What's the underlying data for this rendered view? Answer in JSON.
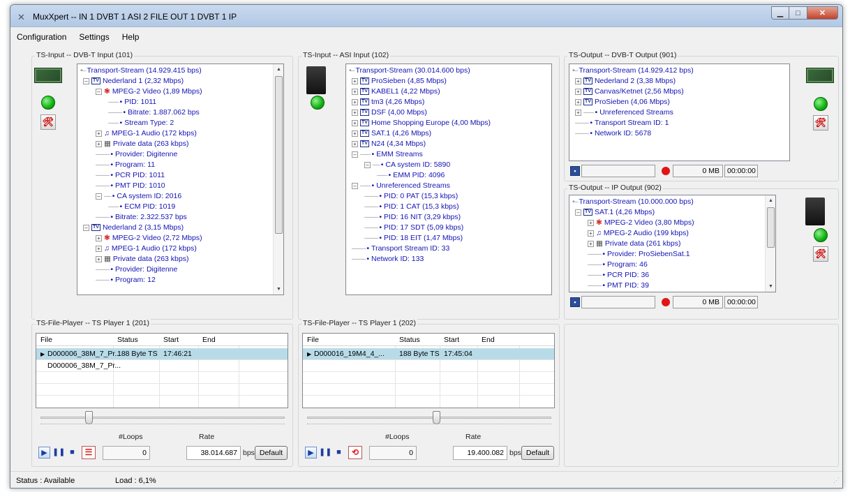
{
  "window": {
    "title": "MuxXpert -- IN 1 DVBT 1 ASI 2 FILE OUT 1 DVBT 1 IP"
  },
  "menu": [
    "Configuration",
    "Settings",
    "Help"
  ],
  "panels": {
    "input1": {
      "title": "TS-Input -- DVB-T Input (101)",
      "rows": [
        "Transport-Stream (14.929.415 bps)",
        "Nederland 1 (2,32 Mbps)",
        "MPEG-2 Video (1,89 Mbps)",
        "PID: 1011",
        "Bitrate: 1.887.062 bps",
        "Stream Type: 2",
        "MPEG-1 Audio (172 kbps)",
        "Private data (263 kbps)",
        "Provider: Digitenne",
        "Program: 11",
        "PCR PID: 1011",
        "PMT PID: 1010",
        "CA system ID: 2016",
        "ECM PID: 1019",
        "Bitrate: 2.322.537 bps",
        "Nederland 2 (3,15 Mbps)",
        "MPEG-2 Video (2,72 Mbps)",
        "MPEG-1 Audio (172 kbps)",
        "Private data (263 kbps)",
        "Provider: Digitenne",
        "Program: 12"
      ]
    },
    "input2": {
      "title": "TS-Input -- ASI Input (102)",
      "rows": [
        "Transport-Stream (30.014.600 bps)",
        "ProSieben (4,85 Mbps)",
        "KABEL1 (4,22 Mbps)",
        "tm3 (4,26 Mbps)",
        "DSF (4,00 Mbps)",
        "Home Shopping Europe (4,00 Mbps)",
        "SAT.1 (4,26 Mbps)",
        "N24 (4,34 Mbps)",
        "EMM Streams",
        "CA system ID: 5890",
        "EMM PID: 4096",
        "Unreferenced Streams",
        "PID: 0 PAT (15,3 kbps)",
        "PID: 1 CAT (15,3 kbps)",
        "PID: 16 NIT (3,29 kbps)",
        "PID: 17 SDT (5,09 kbps)",
        "PID: 18 EIT (1,47 Mbps)",
        "Transport Stream ID: 33",
        "Network ID: 133"
      ]
    },
    "output1": {
      "title": "TS-Output -- DVB-T Output (901)",
      "rows": [
        "Transport-Stream (14.929.412 bps)",
        "Nederland 2 (3,38 Mbps)",
        "Canvas/Ketnet (2,56 Mbps)",
        "ProSieben (4,06 Mbps)",
        "Unreferenced Streams",
        "Transport Stream ID: 1",
        "Network ID: 5678"
      ],
      "size": "0 MB",
      "time": "00:00:00"
    },
    "output2": {
      "title": "TS-Output -- IP Output (902)",
      "rows": [
        "Transport-Stream (10.000.000 bps)",
        "SAT.1 (4,26 Mbps)",
        "MPEG-2 Video (3,80 Mbps)",
        "MPEG-2 Audio (199 kbps)",
        "Private data (261 kbps)",
        "Provider: ProSiebenSat.1",
        "Program: 46",
        "PCR PID: 36",
        "PMT PID: 39"
      ],
      "size": "0 MB",
      "time": "00:00:00"
    },
    "player1": {
      "title": "TS-File-Player -- TS Player 1 (201)",
      "columns": [
        "File",
        "Status",
        "Start",
        "End"
      ],
      "rows": [
        {
          "file": "D000006_38M_7_Pr...",
          "status": "188 Byte TS",
          "start": "17:46:21",
          "end": ""
        },
        {
          "file": "D000006_38M_7_Pr...",
          "status": "",
          "start": "",
          "end": ""
        }
      ],
      "loops_label": "#Loops",
      "rate_label": "Rate",
      "loops": "0",
      "rate": "38.014.687",
      "rate_unit": "bps",
      "default_label": "Default"
    },
    "player2": {
      "title": "TS-File-Player -- TS Player 1 (202)",
      "columns": [
        "File",
        "Status",
        "Start",
        "End"
      ],
      "rows": [
        {
          "file": "D000016_19M4_4_...",
          "status": "188 Byte TS",
          "start": "17:45:04",
          "end": ""
        }
      ],
      "loops_label": "#Loops",
      "rate_label": "Rate",
      "loops": "0",
      "rate": "19.400.082",
      "rate_unit": "bps",
      "default_label": "Default"
    }
  },
  "status": {
    "text": "Status : Available",
    "load": "Load : 6,1%"
  },
  "colors": {
    "tree_text": "#1414b4",
    "selected_row": "#b8dbe8",
    "led": "#11b011",
    "record": "#e01515"
  }
}
